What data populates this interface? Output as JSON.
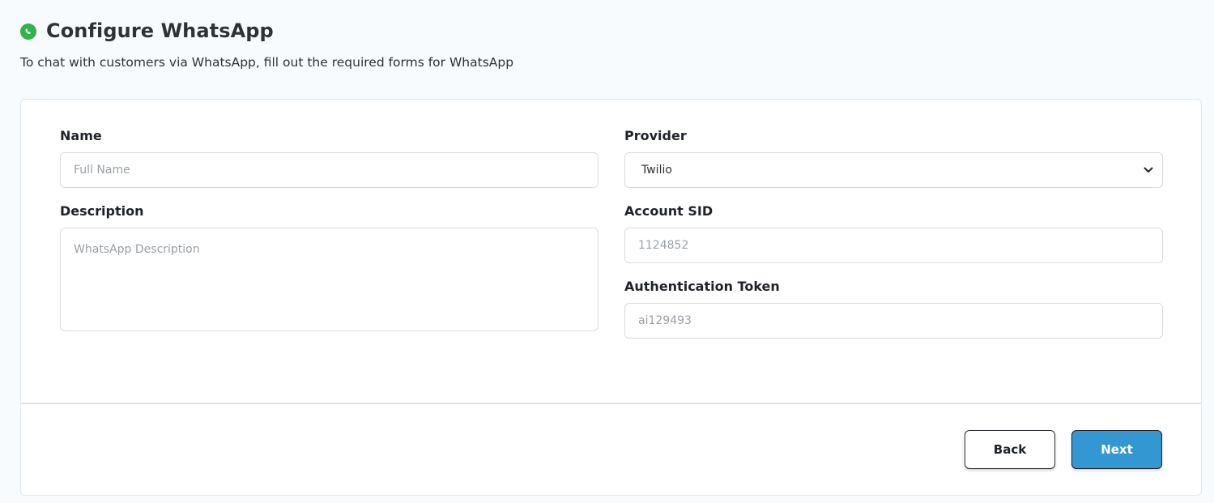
{
  "header": {
    "title": "Configure WhatsApp",
    "subtitle": "To chat with customers via WhatsApp, fill out the required forms for WhatsApp",
    "icon": "whatsapp-icon",
    "icon_color": "#2fb34a"
  },
  "form": {
    "name": {
      "label": "Name",
      "placeholder": "Full Name",
      "value": ""
    },
    "description": {
      "label": "Description",
      "placeholder": "WhatsApp Description",
      "value": ""
    },
    "provider": {
      "label": "Provider",
      "selected": "Twilio"
    },
    "account_sid": {
      "label": "Account SID",
      "placeholder": "1124852",
      "value": ""
    },
    "auth_token": {
      "label": "Authentication Token",
      "placeholder": "ai129493",
      "value": ""
    }
  },
  "footer": {
    "back_label": "Back",
    "next_label": "Next",
    "next_color": "#3398d1"
  }
}
